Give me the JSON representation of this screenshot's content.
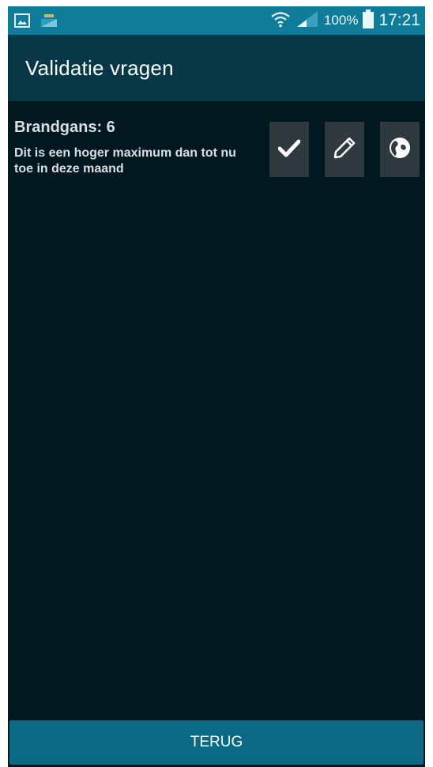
{
  "status_bar": {
    "left_icons": [
      "gallery-icon",
      "data-saver-icon"
    ],
    "battery_percent": "100%",
    "time": "17:21",
    "right_icons": [
      "wifi-icon",
      "signal-icon",
      "battery-icon"
    ]
  },
  "app_bar": {
    "title": "Validatie vragen"
  },
  "validation_items": [
    {
      "title": "Brandgans: 6",
      "description": "Dit is een hoger maximum dan tot nu toe in deze maand",
      "actions": [
        "check-icon",
        "pencil-icon",
        "globe-icon"
      ]
    }
  ],
  "footer": {
    "back_label": "TERUG"
  },
  "colors": {
    "status_bar": "#0f7d99",
    "app_bar": "#063848",
    "background": "#021820",
    "action_button": "#2f3a3f",
    "bottom_button": "#0c6985"
  }
}
